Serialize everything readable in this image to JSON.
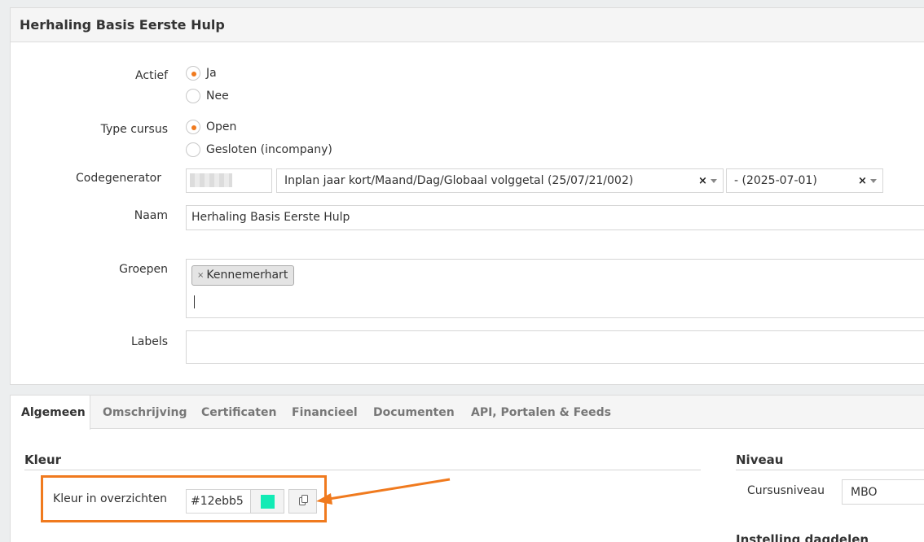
{
  "header": {
    "title": "Herhaling Basis Eerste Hulp"
  },
  "form": {
    "actief": {
      "label": "Actief",
      "options": [
        "Ja",
        "Nee"
      ],
      "selected": "Ja"
    },
    "type_cursus": {
      "label": "Type cursus",
      "options": [
        "Open",
        "Gesloten (incompany)"
      ],
      "selected": "Open"
    },
    "codegenerator": {
      "label": "Codegenerator",
      "format_select": "Inplan jaar kort/Maand/Dag/Globaal volggetal (25/07/21/002)",
      "date_select": "- (2025-07-01)",
      "clear_glyph": "×"
    },
    "naam": {
      "label": "Naam",
      "value": "Herhaling Basis Eerste Hulp"
    },
    "groepen": {
      "label": "Groepen",
      "tags": [
        "Kennemerhart"
      ],
      "tag_remove_glyph": "×"
    },
    "labels": {
      "label": "Labels"
    }
  },
  "tabs": [
    {
      "label": "Algemeen",
      "active": true
    },
    {
      "label": "Omschrijving",
      "active": false
    },
    {
      "label": "Certificaten",
      "active": false
    },
    {
      "label": "Financieel",
      "active": false
    },
    {
      "label": "Documenten",
      "active": false
    },
    {
      "label": "API, Portalen & Feeds",
      "active": false
    }
  ],
  "kleur": {
    "section_title": "Kleur",
    "field_label": "Kleur in overzichten",
    "hex_value": "#12ebb5",
    "swatch_color": "#12ebb5",
    "copy_icon": "copy-icon"
  },
  "niveau": {
    "section_title": "Niveau",
    "cursusniveau_label": "Cursusniveau",
    "cursusniveau_value": "MBO"
  },
  "dagdelen": {
    "section_title": "Instelling dagdelen"
  },
  "colors": {
    "accent": "#f07a1e",
    "highlight": "#f07a1e"
  }
}
